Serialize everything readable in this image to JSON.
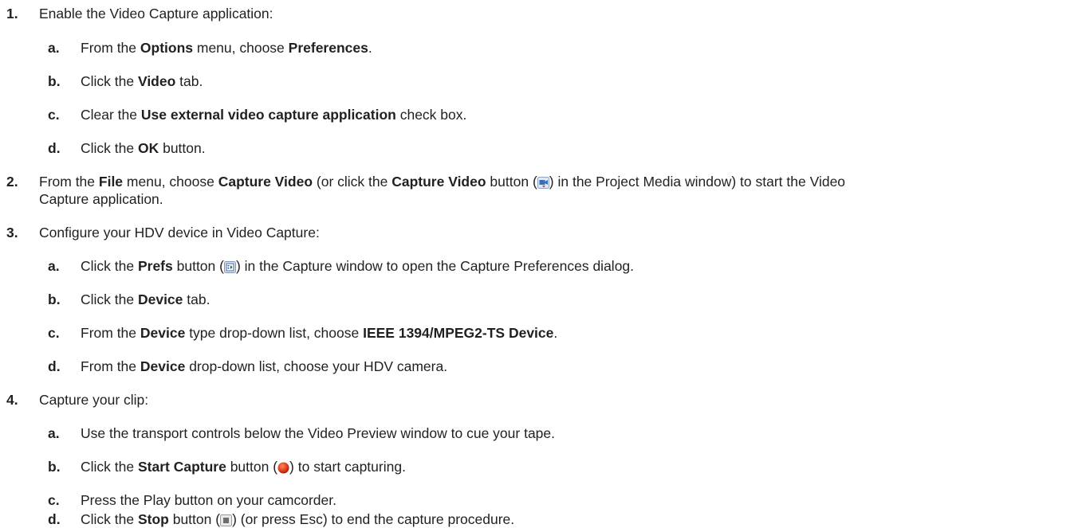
{
  "steps": [
    {
      "num": "1.",
      "text": "Enable the Video Capture application:",
      "subs": [
        {
          "num": "a.",
          "t1": "From the ",
          "b1": "Options",
          "t2": " menu, choose ",
          "b2": "Preferences",
          "t3": "."
        },
        {
          "num": "b.",
          "t1": "Click the ",
          "b1": "Video",
          "t2": " tab."
        },
        {
          "num": "c.",
          "t1": "Clear the ",
          "b1": "Use external video capture application",
          "t2": " check box."
        },
        {
          "num": "d.",
          "t1": "Click the ",
          "b1": "OK",
          "t2": " button."
        }
      ]
    },
    {
      "num": "2.",
      "t1": "From the ",
      "b1": "File",
      "t2": " menu, choose ",
      "b2": "Capture Video",
      "t3": " (or click the ",
      "b3": "Capture Video",
      "t4": " button (",
      "t5": ") in the Project Media window) to start the Video",
      "line2": "Capture application."
    },
    {
      "num": "3.",
      "text": "Configure your HDV device in Video Capture:",
      "subs": [
        {
          "num": "a.",
          "t1": "Click the ",
          "b1": "Prefs",
          "t2": " button (",
          "t3": ") in the Capture window to open the Capture Preferences dialog."
        },
        {
          "num": "b.",
          "t1": "Click the ",
          "b1": "Device",
          "t2": " tab."
        },
        {
          "num": "c.",
          "t1": "From the ",
          "b1": "Device",
          "t2": " type drop-down list, choose ",
          "b2": "IEEE 1394/MPEG2-TS Device",
          "t3": "."
        },
        {
          "num": "d.",
          "t1": "From the ",
          "b1": "Device",
          "t2": " drop-down list, choose your HDV camera."
        }
      ]
    },
    {
      "num": "4.",
      "text": "Capture your clip:",
      "subs": [
        {
          "num": "a.",
          "t1": "Use the transport controls below the Video Preview window to cue your tape."
        },
        {
          "num": "b.",
          "t1": "Click the ",
          "b1": "Start Capture",
          "t2": " button (",
          "t3": ") to start capturing."
        },
        {
          "num": "c.",
          "t1": "Press the Play button on your camcorder."
        },
        {
          "num": "d.",
          "t1": "Click the ",
          "b1": "Stop",
          "t2": " button (",
          "t3": ") (or press Esc) to end the capture procedure."
        }
      ]
    }
  ],
  "icons": {
    "capture_video": "capture-video-icon",
    "prefs": "prefs-icon",
    "start_capture": "record-icon",
    "stop": "stop-icon"
  }
}
